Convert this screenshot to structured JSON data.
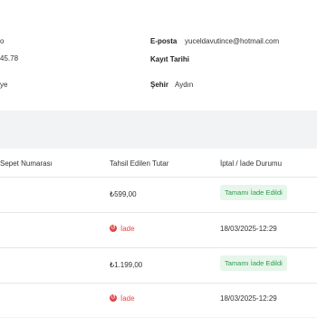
{
  "customer_info": {
    "left_fragments": [
      "o",
      "45.78",
      "ye"
    ],
    "email_label": "E-posta",
    "email_value": "yuceldavutince@hotmail.com",
    "registration_label": "Kayıt Tarihi",
    "registration_value": "",
    "city_label": "Şehir",
    "city_value": "Aydın"
  },
  "table": {
    "headers": {
      "basket_number": "Sepet Numarası",
      "amount": "Tahsil Edilen Tutar",
      "cancel_status": "İptal / İade Durumu"
    },
    "rows": [
      {
        "type": "payment",
        "amount": "₺599,00",
        "status_badge": "Tamamı İade Edildi"
      },
      {
        "type": "refund",
        "refund_label": "İade",
        "date": "18/03/2025-12:29"
      },
      {
        "type": "payment",
        "amount": "₺1.199,00",
        "status_badge": "Tamamı İade Edildi"
      },
      {
        "type": "refund",
        "refund_label": "İade",
        "date": "18/03/2025-12:29"
      }
    ],
    "colors": {
      "refund": "#e04848",
      "badge_bg": "#e6f6ea",
      "badge_text": "#2f9a4d"
    }
  }
}
